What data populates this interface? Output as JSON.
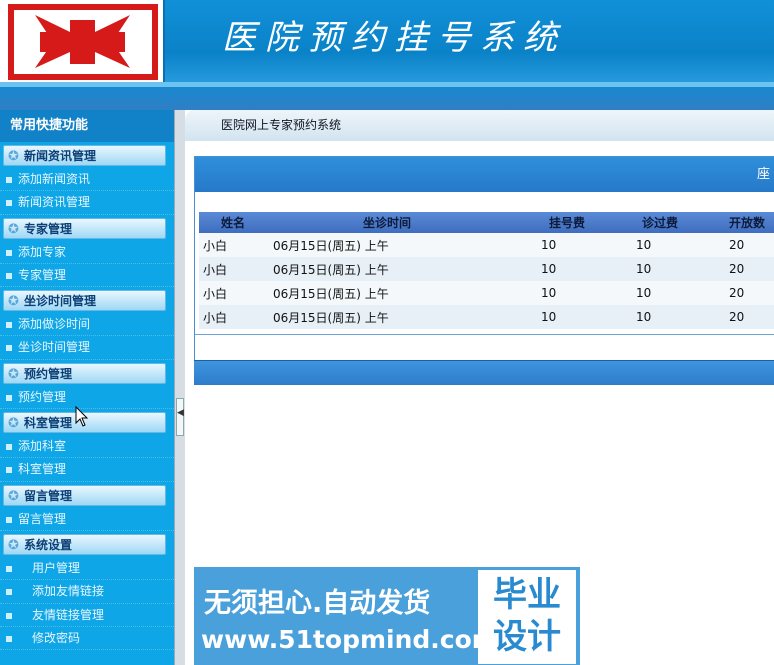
{
  "header": {
    "title": "医院预约挂号系统",
    "logo_icon": "red-cross-icon"
  },
  "sidebar": {
    "title": "常用快捷功能",
    "groups": [
      {
        "label": "新闻资讯管理",
        "items": [
          "添加新闻资讯",
          "新闻资讯管理"
        ]
      },
      {
        "label": "专家管理",
        "items": [
          "添加专家",
          "专家管理"
        ]
      },
      {
        "label": "坐诊时间管理",
        "items": [
          "添加做诊时间",
          "坐诊时间管理"
        ]
      },
      {
        "label": "预约管理",
        "items": [
          "预约管理"
        ]
      },
      {
        "label": "科室管理",
        "items": [
          "添加科室",
          "科室管理"
        ]
      },
      {
        "label": "留言管理",
        "items": [
          "留言管理"
        ]
      },
      {
        "label": "系统设置",
        "items": [
          "用户管理",
          "添加友情链接",
          "友情链接管理",
          "修改密码"
        ]
      }
    ]
  },
  "breadcrumb": "医院网上专家预约系统",
  "panel": {
    "title": "座",
    "columns": [
      "姓名",
      "坐诊时间",
      "挂号费",
      "诊过费",
      "开放数"
    ],
    "rows": [
      [
        "小白",
        "06月15日(周五) 上午",
        "10",
        "10",
        "20"
      ],
      [
        "小白",
        "06月15日(周五) 上午",
        "10",
        "10",
        "20"
      ],
      [
        "小白",
        "06月15日(周五) 上午",
        "10",
        "10",
        "20"
      ],
      [
        "小白",
        "06月15日(周五) 上午",
        "10",
        "10",
        "20"
      ]
    ]
  },
  "banner": {
    "line1": "无须担心.自动发货",
    "line2": "www.51topmind.com",
    "right_top": "毕业",
    "right_bottom": "设计"
  }
}
